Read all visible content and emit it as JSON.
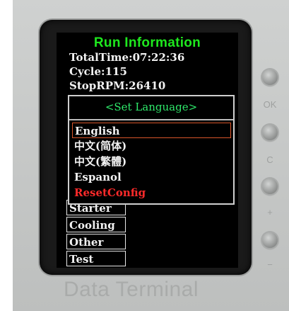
{
  "screen": {
    "title": "Run Information",
    "info": [
      "TotalTime:07:22:36",
      "Cycle:115",
      "StopRPM:26410"
    ],
    "menu_items": [
      "Starter",
      "Cooling",
      "Other",
      "Test"
    ]
  },
  "popup": {
    "title": "<Set Language>",
    "options": [
      {
        "label": "English",
        "selected": true
      },
      {
        "label": "中文(简体)",
        "selected": false
      },
      {
        "label": "中文(繁體)",
        "selected": false
      },
      {
        "label": "Espanol",
        "selected": false
      },
      {
        "label": "ResetConfig",
        "selected": false
      }
    ]
  },
  "buttons": {
    "labels": [
      "OK",
      "C",
      "+",
      "−"
    ]
  },
  "device": {
    "brand": "Data Terminal"
  },
  "colors": {
    "title_green": "#1ee81e",
    "popup_title_green": "#2ee86a",
    "selection_border": "#d8552a",
    "reset_red": "#ff2a2a"
  }
}
